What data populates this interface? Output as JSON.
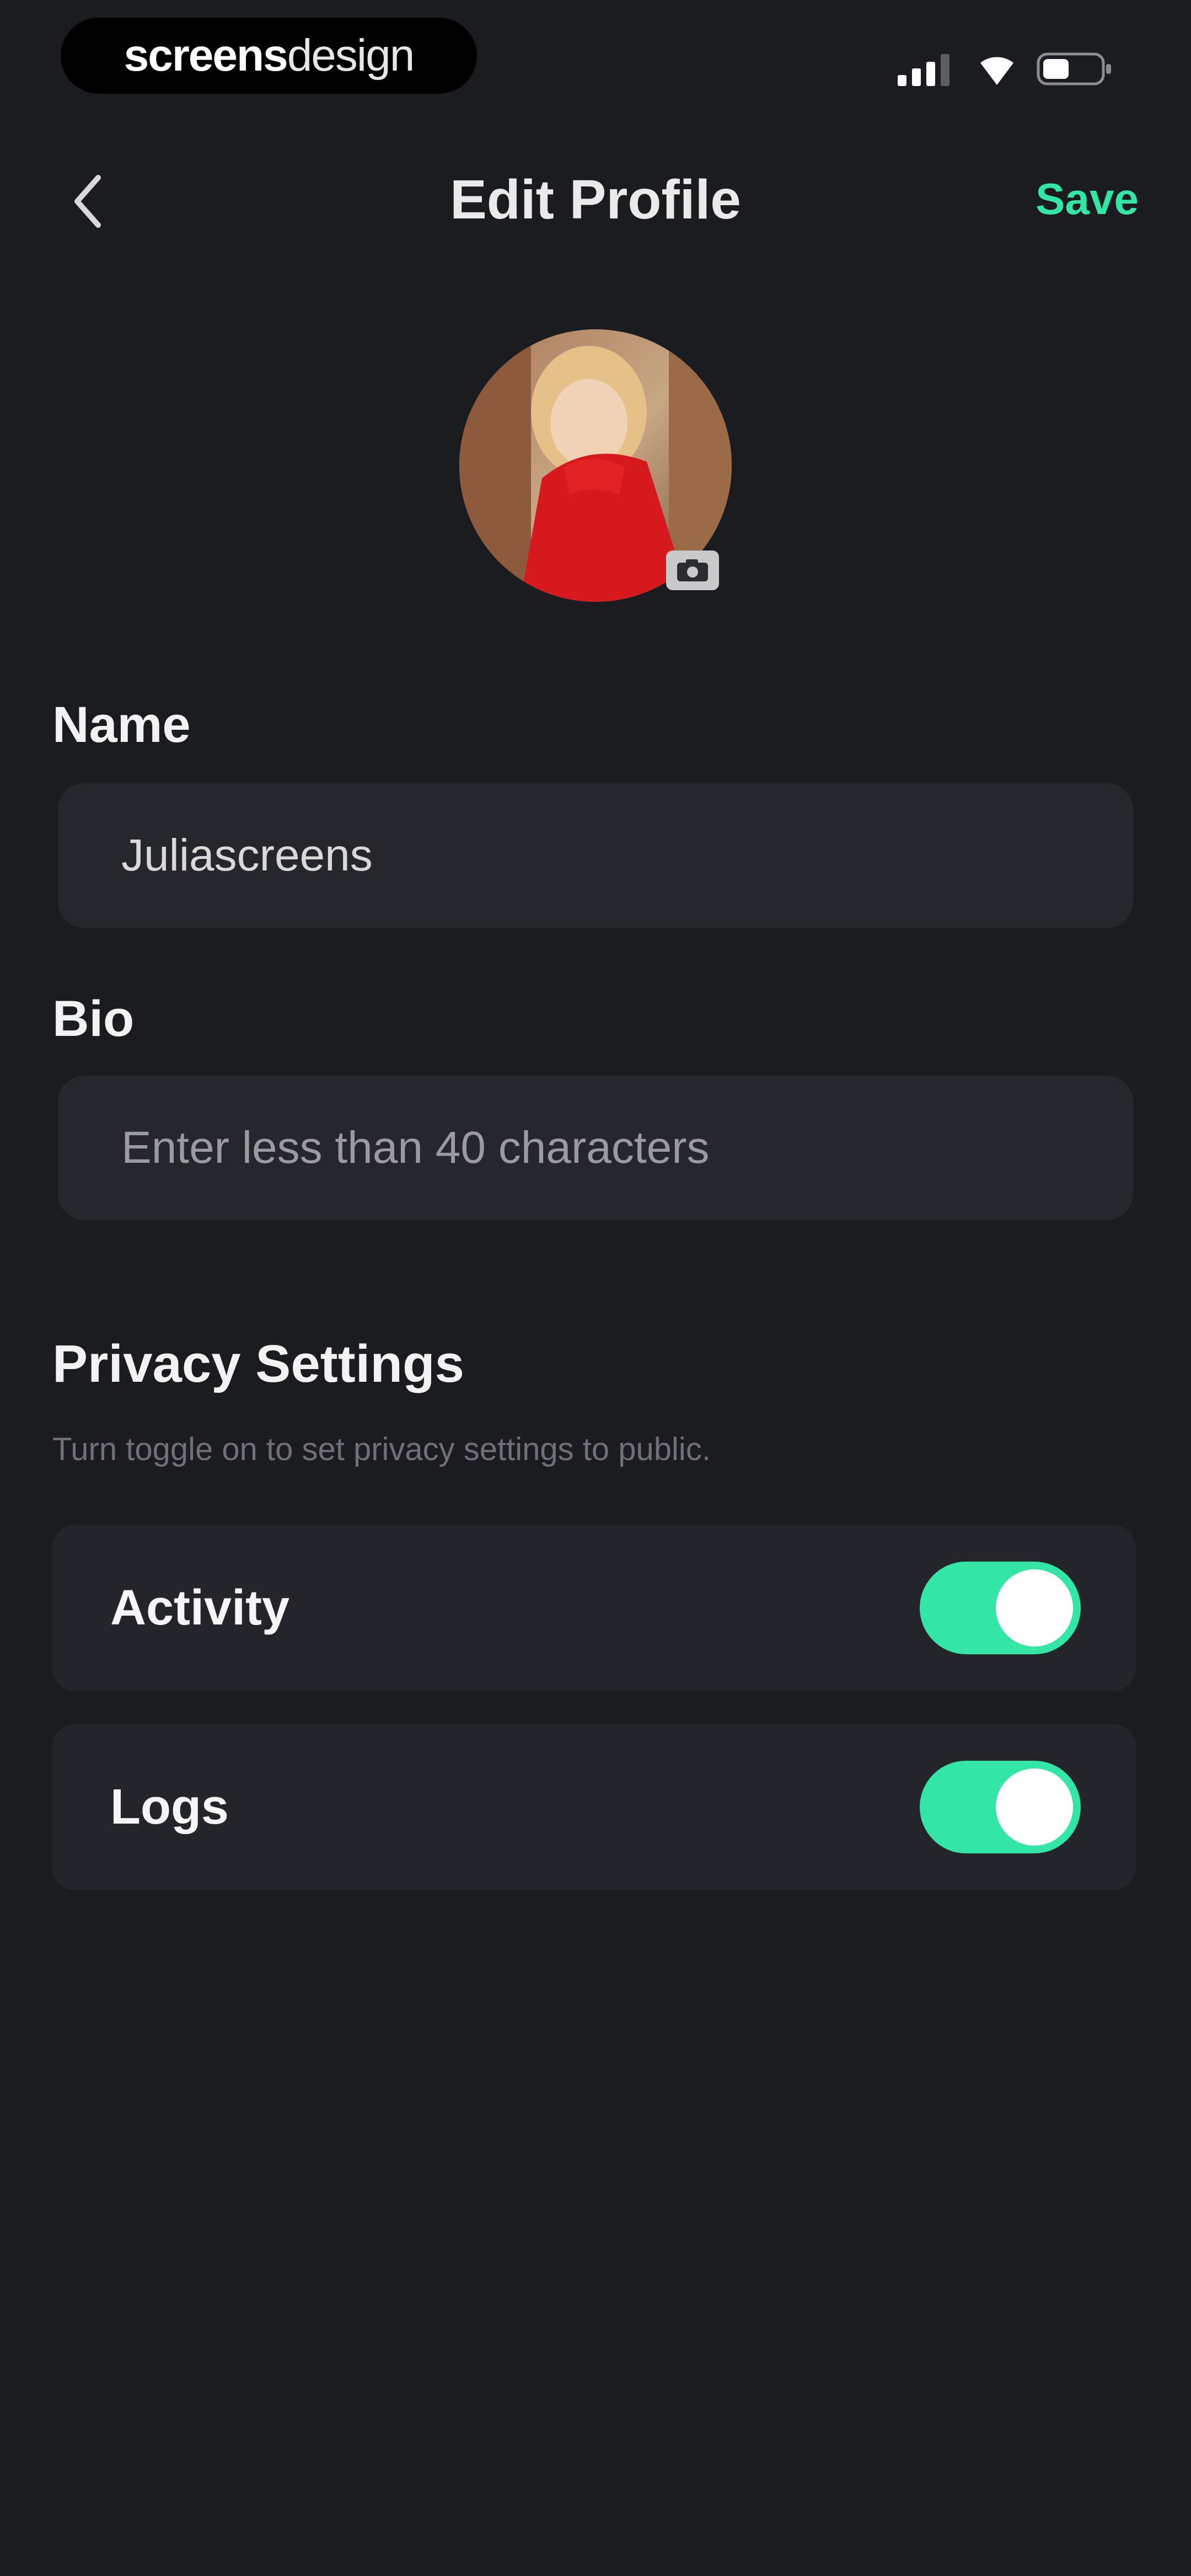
{
  "status_bar": {
    "brand_bold": "screens",
    "brand_light": "design",
    "icons": [
      "signal-icon",
      "wifi-icon",
      "battery-icon"
    ]
  },
  "header": {
    "title": "Edit Profile",
    "save_label": "Save",
    "back_icon": "chevron-left-icon"
  },
  "profile": {
    "avatar_icon": "avatar-photo",
    "camera_icon": "camera-icon"
  },
  "form": {
    "name_label": "Name",
    "name_value": "Juliascreens",
    "bio_label": "Bio",
    "bio_placeholder": "Enter less than 40 characters"
  },
  "privacy": {
    "title": "Privacy Settings",
    "subtitle": "Turn toggle on to set privacy settings to public.",
    "items": [
      {
        "label": "Activity",
        "enabled": true
      },
      {
        "label": "Logs",
        "enabled": true
      }
    ]
  },
  "colors": {
    "background": "#1b1c20",
    "accent": "#33e6a6",
    "field": "#26272c"
  }
}
